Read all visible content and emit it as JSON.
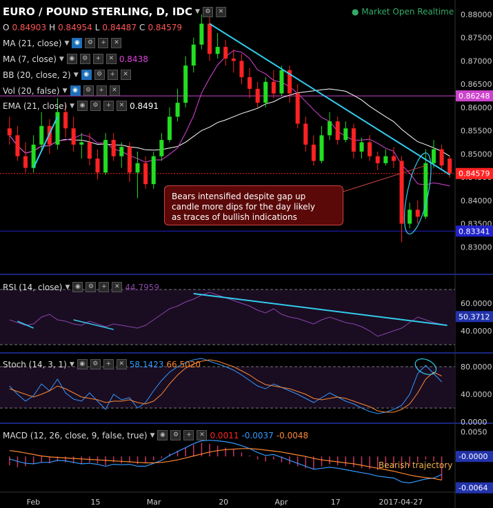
{
  "header": {
    "title": "EURO / POUND STERLING, D, IDC",
    "status": "Market Open",
    "mode": "Realtime",
    "ohlc": [
      {
        "k": "O",
        "v": "0.84903"
      },
      {
        "k": "H",
        "v": "0.84954"
      },
      {
        "k": "L",
        "v": "0.84487"
      },
      {
        "k": "C",
        "v": "0.84579"
      }
    ]
  },
  "indicators": {
    "ma21": {
      "label": "MA (21, close)"
    },
    "ma7": {
      "label": "MA (7, close)",
      "value": "0.8438"
    },
    "bb": {
      "label": "BB (20, close, 2)"
    },
    "vol": {
      "label": "Vol (20, false)"
    },
    "ema": {
      "label": "EMA (21, close)",
      "value": "0.8491"
    }
  },
  "annotations": {
    "note_lines": [
      "Bears intensified despite gap up",
      "candle more dips for the day likely",
      "as traces of bullish indications"
    ],
    "bearish": "Bearish trajectory"
  },
  "colors": {
    "up": "#22dd22",
    "down": "#ff2222",
    "rsi": "#8844aa",
    "stoch_k": "#3399ff",
    "stoch_d": "#ff8833",
    "trend": "#33ccee",
    "ma7": "#dd44dd",
    "ma21": "#ffffff"
  },
  "chart_data": [
    {
      "type": "candlestick",
      "title": "EURO / POUND STERLING, D, IDC",
      "ylim": [
        0.825,
        0.8825
      ],
      "y_ticks": [
        "0.88000",
        "0.87500",
        "0.87000",
        "0.86500",
        "0.86000",
        "0.85500",
        "0.85000",
        "0.84500",
        "0.84000",
        "0.83500",
        "0.83000"
      ],
      "price_labels": [
        {
          "text": "0.86248",
          "value": 0.86248,
          "color": "#cc44cc"
        },
        {
          "text": "0.84579",
          "value": 0.84579,
          "color": "#ff2222"
        },
        {
          "text": "0.83341",
          "value": 0.83341,
          "color": "#2222cc"
        }
      ],
      "horizontal_lines": [
        0.86248,
        0.84579,
        0.83341
      ],
      "x_labels": [
        {
          "text": "Feb",
          "i": 3
        },
        {
          "text": "15",
          "i": 11
        },
        {
          "text": "Mar",
          "i": 18
        },
        {
          "text": "20",
          "i": 27
        },
        {
          "text": "Apr",
          "i": 34
        },
        {
          "text": "17",
          "i": 41
        },
        {
          "text": "2017-04-27",
          "i": 47
        }
      ],
      "candles": [
        [
          0.8555,
          0.854,
          0.858,
          0.852
        ],
        [
          0.854,
          0.8495,
          0.856,
          0.8485
        ],
        [
          0.8495,
          0.847,
          0.8525,
          0.846
        ],
        [
          0.847,
          0.852,
          0.854,
          0.846
        ],
        [
          0.852,
          0.856,
          0.859,
          0.8505
        ],
        [
          0.856,
          0.852,
          0.8575,
          0.85
        ],
        [
          0.852,
          0.859,
          0.862,
          0.851
        ],
        [
          0.859,
          0.8555,
          0.861,
          0.8535
        ],
        [
          0.8555,
          0.852,
          0.858,
          0.8505
        ],
        [
          0.852,
          0.8525,
          0.8545,
          0.849
        ],
        [
          0.8525,
          0.849,
          0.8545,
          0.8475
        ],
        [
          0.849,
          0.846,
          0.851,
          0.8445
        ],
        [
          0.846,
          0.853,
          0.8545,
          0.8455
        ],
        [
          0.853,
          0.8495,
          0.8545,
          0.8485
        ],
        [
          0.8495,
          0.8515,
          0.8525,
          0.847
        ],
        [
          0.8515,
          0.846,
          0.8525,
          0.844
        ],
        [
          0.846,
          0.848,
          0.8505,
          0.8405
        ],
        [
          0.848,
          0.8435,
          0.8495,
          0.8425
        ],
        [
          0.8435,
          0.8495,
          0.8505,
          0.8425
        ],
        [
          0.8495,
          0.853,
          0.8545,
          0.8485
        ],
        [
          0.853,
          0.858,
          0.86,
          0.8525
        ],
        [
          0.858,
          0.861,
          0.864,
          0.857
        ],
        [
          0.861,
          0.869,
          0.871,
          0.86
        ],
        [
          0.869,
          0.8735,
          0.875,
          0.8675
        ],
        [
          0.8735,
          0.878,
          0.88,
          0.8725
        ],
        [
          0.878,
          0.8715,
          0.8795,
          0.87
        ],
        [
          0.8715,
          0.873,
          0.876,
          0.8705
        ],
        [
          0.873,
          0.8705,
          0.8745,
          0.869
        ],
        [
          0.8705,
          0.87,
          0.8725,
          0.8675
        ],
        [
          0.87,
          0.8665,
          0.8715,
          0.865
        ],
        [
          0.8665,
          0.864,
          0.8685,
          0.862
        ],
        [
          0.864,
          0.861,
          0.8655,
          0.86
        ],
        [
          0.861,
          0.8655,
          0.8665,
          0.86
        ],
        [
          0.8655,
          0.863,
          0.868,
          0.862
        ],
        [
          0.863,
          0.868,
          0.869,
          0.8625
        ],
        [
          0.868,
          0.863,
          0.869,
          0.861
        ],
        [
          0.863,
          0.8565,
          0.865,
          0.8555
        ],
        [
          0.8565,
          0.852,
          0.858,
          0.8505
        ],
        [
          0.852,
          0.8485,
          0.854,
          0.8475
        ],
        [
          0.8485,
          0.854,
          0.856,
          0.848
        ],
        [
          0.854,
          0.857,
          0.859,
          0.853
        ],
        [
          0.857,
          0.853,
          0.858,
          0.852
        ],
        [
          0.853,
          0.8555,
          0.857,
          0.8525
        ],
        [
          0.8555,
          0.8505,
          0.8565,
          0.849
        ],
        [
          0.8505,
          0.8525,
          0.8535,
          0.849
        ],
        [
          0.8525,
          0.8495,
          0.854,
          0.8485
        ],
        [
          0.8495,
          0.848,
          0.8505,
          0.8465
        ],
        [
          0.848,
          0.8495,
          0.851,
          0.8475
        ],
        [
          0.8495,
          0.8485,
          0.8515,
          0.847
        ],
        [
          0.8485,
          0.835,
          0.8495,
          0.831
        ],
        [
          0.835,
          0.838,
          0.8395,
          0.834
        ],
        [
          0.838,
          0.8365,
          0.84,
          0.835
        ],
        [
          0.8365,
          0.848,
          0.851,
          0.836
        ],
        [
          0.848,
          0.851,
          0.853,
          0.847
        ],
        [
          0.851,
          0.8475,
          0.852,
          0.8465
        ],
        [
          0.849,
          0.8458,
          0.8495,
          0.8449
        ]
      ]
    },
    {
      "type": "line",
      "title": "RSI (14, close)",
      "value": "44.7959",
      "ylim": [
        0,
        100
      ],
      "y_ticks": [
        "60.0000",
        "40.0000"
      ],
      "price_label": {
        "text": "50.3712",
        "value": 50.37
      },
      "values": [
        48,
        46,
        44,
        45,
        50,
        52,
        48,
        47,
        45,
        44,
        47,
        45,
        43,
        45,
        44,
        43,
        42,
        44,
        48,
        52,
        56,
        58,
        61,
        63,
        66,
        68,
        66,
        64,
        62,
        60,
        58,
        55,
        53,
        56,
        52,
        50,
        49,
        47,
        45,
        48,
        50,
        48,
        46,
        45,
        43,
        40,
        36,
        38,
        40,
        42,
        46,
        50,
        48,
        46,
        44.8
      ]
    },
    {
      "type": "line",
      "title": "Stoch (14, 3, 1)",
      "k_value": "58.1423",
      "d_value": "66.5020",
      "ylim": [
        0,
        100
      ],
      "y_ticks": [
        "80.0000",
        "40.0000",
        "0.0000"
      ],
      "series": [
        {
          "name": "%K",
          "values": [
            52,
            40,
            30,
            38,
            55,
            45,
            62,
            42,
            33,
            30,
            42,
            30,
            18,
            40,
            32,
            35,
            20,
            28,
            45,
            60,
            72,
            80,
            86,
            90,
            92,
            88,
            84,
            80,
            75,
            68,
            60,
            52,
            48,
            55,
            50,
            45,
            40,
            34,
            28,
            35,
            42,
            36,
            30,
            26,
            20,
            15,
            12,
            14,
            18,
            24,
            40,
            70,
            82,
            70,
            58
          ]
        },
        {
          "name": "%D",
          "values": [
            48,
            44,
            40,
            36,
            40,
            45,
            52,
            48,
            42,
            36,
            34,
            32,
            28,
            30,
            30,
            32,
            28,
            26,
            30,
            40,
            55,
            68,
            78,
            84,
            88,
            90,
            88,
            84,
            80,
            74,
            68,
            60,
            54,
            52,
            50,
            48,
            44,
            40,
            34,
            32,
            34,
            36,
            34,
            30,
            26,
            22,
            16,
            14,
            14,
            18,
            26,
            42,
            62,
            72,
            66.5
          ]
        }
      ]
    },
    {
      "type": "bar",
      "title": "MACD (12, 26, close, 9, false, true)",
      "macd_value": "0.0011",
      "signal_value": "-0.0037",
      "hist_value": "-0.0048",
      "y_ticks": [
        "0.0050",
        "-0.0000"
      ],
      "price_labels": [
        {
          "text": "-0.0000",
          "value": 0.0
        },
        {
          "text": "-0.0064",
          "value": -0.0064
        }
      ],
      "ylim": [
        -0.007,
        0.0065
      ],
      "histogram": [
        -0.0018,
        -0.0022,
        -0.002,
        -0.0016,
        -0.0012,
        -0.0014,
        -0.001,
        -0.0012,
        -0.0014,
        -0.0016,
        -0.0012,
        -0.0014,
        -0.0018,
        -0.0012,
        -0.0014,
        -0.0012,
        -0.0016,
        -0.0014,
        -0.0008,
        -0.0004,
        0.0006,
        0.0012,
        0.0018,
        0.0024,
        0.0028,
        0.0026,
        0.0022,
        0.0018,
        0.0014,
        0.0008,
        0.0002,
        -0.0006,
        -0.001,
        -0.0006,
        -0.0012,
        -0.0016,
        -0.002,
        -0.0024,
        -0.0026,
        -0.002,
        -0.0016,
        -0.0018,
        -0.002,
        -0.0022,
        -0.0024,
        -0.0026,
        -0.0028,
        -0.0024,
        -0.0022,
        -0.0026,
        -0.002,
        -0.0012,
        -0.0006,
        -0.001,
        -0.0048
      ],
      "series": [
        {
          "name": "MACD",
          "values": [
            -0.0005,
            -0.001,
            -0.0014,
            -0.0015,
            -0.0012,
            -0.0012,
            -0.0008,
            -0.0009,
            -0.0012,
            -0.0015,
            -0.0014,
            -0.0016,
            -0.002,
            -0.0016,
            -0.0017,
            -0.0016,
            -0.002,
            -0.002,
            -0.0014,
            -0.0008,
            0.0002,
            0.001,
            0.0018,
            0.0026,
            0.0032,
            0.0033,
            0.0032,
            0.003,
            0.0027,
            0.0022,
            0.0016,
            0.0008,
            0.0002,
            0.0004,
            -0.0002,
            -0.0008,
            -0.0014,
            -0.002,
            -0.0026,
            -0.0024,
            -0.0022,
            -0.0024,
            -0.0027,
            -0.003,
            -0.0033,
            -0.0036,
            -0.004,
            -0.0042,
            -0.0044,
            -0.0052,
            -0.0054,
            -0.005,
            -0.0046,
            -0.0044,
            -0.0037
          ]
        },
        {
          "name": "Signal",
          "values": [
            0.0012,
            0.001,
            0.0007,
            0.0004,
            0.0001,
            -0.0001,
            -0.0002,
            -0.0003,
            -0.0004,
            -0.0005,
            -0.0006,
            -0.0007,
            -0.0008,
            -0.0009,
            -0.001,
            -0.0011,
            -0.0012,
            -0.0013,
            -0.0013,
            -0.0012,
            -0.001,
            -0.0007,
            -0.0003,
            0.0001,
            0.0005,
            0.0009,
            0.0012,
            0.0014,
            0.0015,
            0.0016,
            0.0016,
            0.0015,
            0.0013,
            0.0011,
            0.0009,
            0.0006,
            0.0003,
            0.0,
            -0.0004,
            -0.0007,
            -0.0009,
            -0.0011,
            -0.0013,
            -0.0015,
            -0.0018,
            -0.0021,
            -0.0024,
            -0.0027,
            -0.003,
            -0.0034,
            -0.0038,
            -0.0041,
            -0.0043,
            -0.0045,
            -0.0048
          ]
        }
      ]
    }
  ]
}
